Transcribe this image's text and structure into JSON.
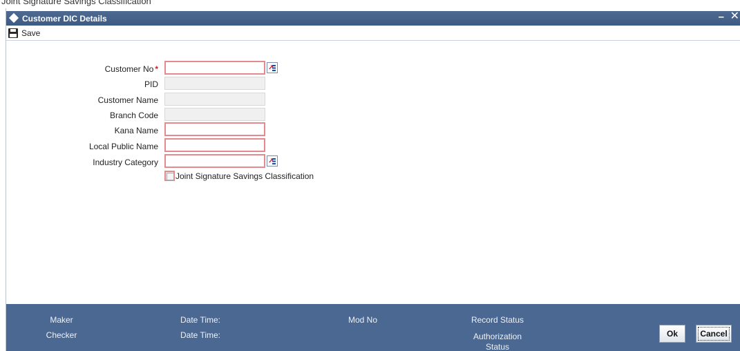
{
  "top_strip": {
    "text": "Joint Signature Savings Classification"
  },
  "window": {
    "title": "Customer DIC Details",
    "minimize": "–",
    "close": "✕"
  },
  "toolbar": {
    "save_label": "Save"
  },
  "form": {
    "customer_no": {
      "label": "Customer No",
      "required_mark": "*",
      "value": ""
    },
    "pid": {
      "label": "PID",
      "value": ""
    },
    "customer_name": {
      "label": "Customer Name",
      "value": ""
    },
    "branch_code": {
      "label": "Branch Code",
      "value": ""
    },
    "kana_name": {
      "label": "Kana Name",
      "value": ""
    },
    "local_public_name": {
      "label": "Local Public Name",
      "value": ""
    },
    "industry_category": {
      "label": "Industry Category",
      "value": ""
    },
    "joint_signature": {
      "label": "Joint Signature Savings Classification",
      "checked": false
    }
  },
  "footer": {
    "maker": "Maker",
    "checker": "Checker",
    "date_time_1": "Date Time:",
    "date_time_2": "Date Time:",
    "mod_no": "Mod No",
    "record_status": "Record Status",
    "authorization_status": "Authorization Status",
    "ok": "Ok",
    "cancel": "Cancel"
  },
  "icons": [
    "diamond-icon",
    "floppy-disk-icon",
    "list-of-values-icon"
  ],
  "colors": {
    "titlebar": "#3d5a83",
    "footer": "#4a6891",
    "required": "#e0161e",
    "active_field_border": "#e48a8e"
  }
}
